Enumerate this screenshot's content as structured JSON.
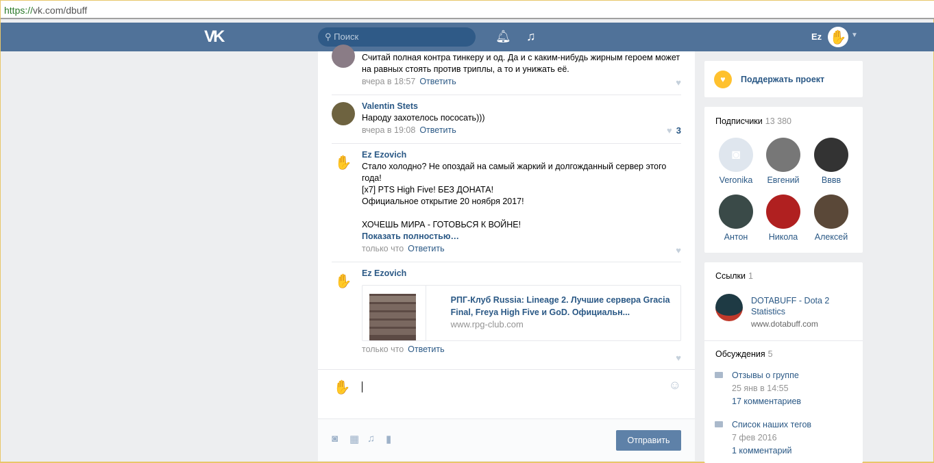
{
  "browser": {
    "url_scheme": "https://",
    "url_rest": "vk.com/dbuff"
  },
  "header": {
    "logo": "VK",
    "search_placeholder": "Поиск",
    "user_name": "Ez"
  },
  "comments": [
    {
      "text": "Считай полная контра тинкеру и од. Да и с каким-нибудь жирным героем может на равных стоять против триплы, а то и унижать её.",
      "time": "вчера в 18:57",
      "reply": "Ответить"
    },
    {
      "author": "Valentin Stets",
      "text": "Народу захотелось пососать)))",
      "time": "вчера в 19:08",
      "reply": "Ответить",
      "likes": "3"
    },
    {
      "author": "Ez Ezovich",
      "lines": [
        "Стало холодно? Не опоздай на самый жаркий и долгожданный сервер этого года!",
        "[x7] PTS High Five! БЕЗ ДОНАТА!",
        "Официальное открытие 20 ноября 2017!",
        "ХОЧЕШЬ МИРА - ГОТОВЬСЯ К ВОЙНЕ!"
      ],
      "show_more": "Показать полностью…",
      "time": "только что",
      "reply": "Ответить"
    },
    {
      "author": "Ez Ezovich",
      "link_title": "РПГ-Клуб Russia: Lineage 2. Лучшие сервера Gracia Final, Freya High Five и GoD. Официальн...",
      "link_domain": "www.rpg-club.com",
      "time": "только что",
      "reply": "Ответить"
    }
  ],
  "composer": {
    "send": "Отправить"
  },
  "sidebar": {
    "support": "Поддержать проект",
    "subscribers": {
      "title": "Подписчики",
      "count": "13 380",
      "items": [
        "Veronika",
        "Евгений",
        "Вввв",
        "Антон",
        "Никола",
        "Алексей"
      ]
    },
    "links": {
      "title": "Ссылки",
      "count": "1",
      "name": "DOTABUFF - Dota 2 Statistics",
      "url": "www.dotabuff.com"
    },
    "discussions": {
      "title": "Обсуждения",
      "count": "5",
      "items": [
        {
          "title": "Отзывы о группе",
          "date": "25 янв в 14:55",
          "comments": "17 комментариев"
        },
        {
          "title": "Список наших тегов",
          "date": "7 фев 2016",
          "comments": "1 комментарий"
        }
      ]
    }
  }
}
